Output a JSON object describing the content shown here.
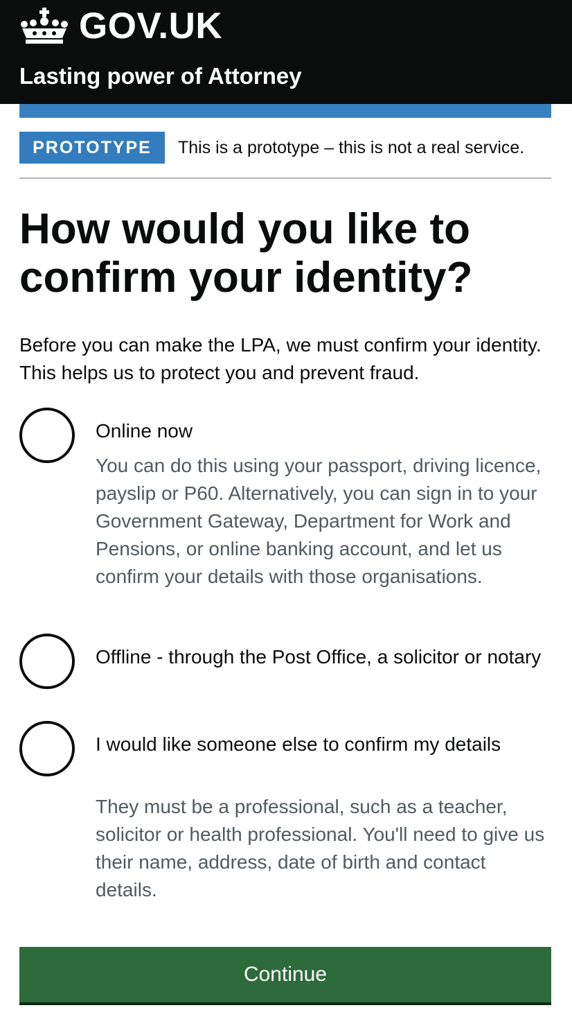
{
  "header": {
    "logo_text": "GOV.UK",
    "logo_icon": "crown-icon",
    "service_name": "Lasting power of Attorney"
  },
  "phase_banner": {
    "tag": "PROTOTYPE",
    "text": "This is a prototype – this is not a real service."
  },
  "page": {
    "title": "How would you like to confirm your identity?",
    "intro": "Before you can make the LPA, we must confirm your identity. This helps us to protect you and prevent fraud."
  },
  "options": [
    {
      "label": "Online now",
      "hint": "You can do this using your passport, driving licence, payslip or P60. Alternatively, you can sign in to your Government Gateway, Department for Work and Pensions, or online banking account, and let us confirm your details with those organisations.",
      "selected": false
    },
    {
      "label": "Offline - through the Post Office, a solicitor or notary",
      "hint": "",
      "selected": false
    },
    {
      "label": "I would like someone else to confirm my details",
      "hint": "They must be a professional, such as a teacher, solicitor or health professional. You'll need to give us their name, address, date of birth and contact details.",
      "selected": false
    }
  ],
  "actions": {
    "continue_label": "Continue"
  },
  "colors": {
    "header_bg": "#0b0c0c",
    "brand_blue": "#1d70b8",
    "button_green": "#2e6b3a",
    "hint_grey": "#505a5f",
    "border_grey": "#b1b4b6"
  }
}
